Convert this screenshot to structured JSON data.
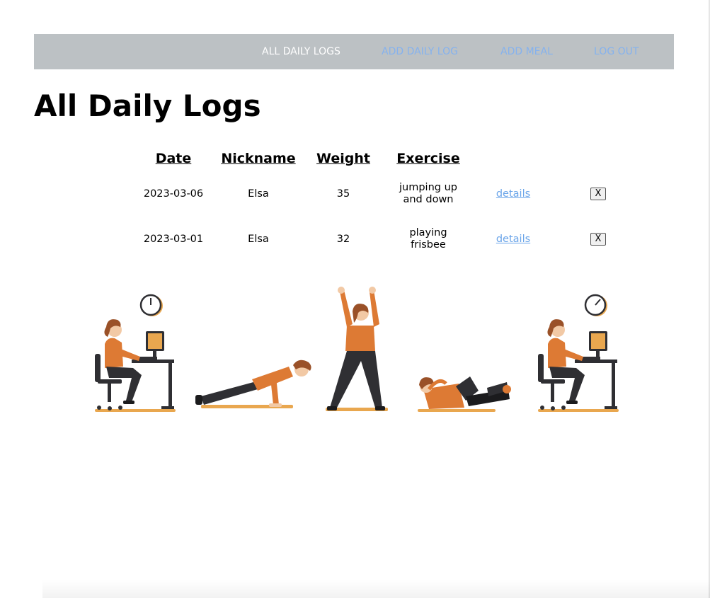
{
  "nav": {
    "items": [
      {
        "label": "ALL DAILY LOGS",
        "active": true
      },
      {
        "label": "ADD DAILY LOG",
        "active": false
      },
      {
        "label": "ADD MEAL",
        "active": false
      },
      {
        "label": "LOG OUT",
        "active": false
      }
    ],
    "bar_color": "#bcc1c4",
    "link_color": "#85b2ee",
    "active_color": "#ffffff"
  },
  "page": {
    "title": "All Daily Logs"
  },
  "table": {
    "headers": [
      "Date",
      "Nickname",
      "Weight",
      "Exercise"
    ],
    "rows": [
      {
        "date": "2023-03-06",
        "nickname": "Elsa",
        "weight": "35",
        "exercise": "jumping up and down",
        "details_label": "details",
        "delete_label": "X"
      },
      {
        "date": "2023-03-01",
        "nickname": "Elsa",
        "weight": "32",
        "exercise": "playing frisbee",
        "details_label": "details",
        "delete_label": "X"
      }
    ]
  },
  "illustration": {
    "icons": [
      "woman-at-desk-icon",
      "clock-icon",
      "pushup-icon",
      "jumping-jack-icon",
      "situp-icon",
      "woman-at-desk-icon",
      "clock-icon"
    ],
    "colors": {
      "shirt": "#dd7a34",
      "pants": "#2f2f33",
      "hair": "#9a5128",
      "skin": "#f2c9a5",
      "mat": "#e9a74f"
    }
  }
}
